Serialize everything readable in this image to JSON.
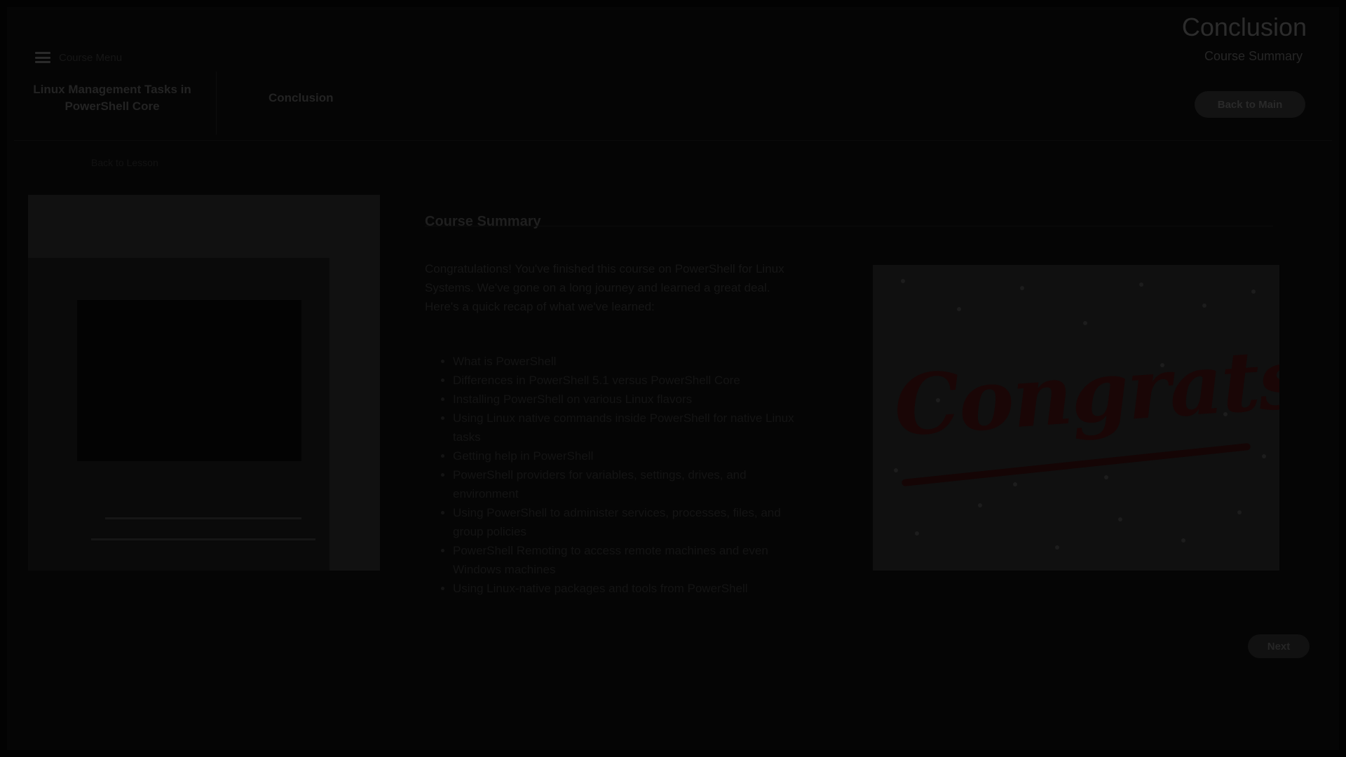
{
  "header": {
    "menu_label": "Course Menu",
    "course_title": "Linux Management Tasks in PowerShell Core",
    "lesson_title": "Conclusion",
    "sub_link": "Back to Lesson",
    "page_title": "Conclusion",
    "page_subtitle": "Course Summary",
    "back_button": "Back to Main"
  },
  "content": {
    "heading": "Course Summary",
    "intro": "Congratulations! You've finished this course on PowerShell for Linux Systems. We've gone on a long journey and learned a great deal. Here's a quick recap of what we've learned:",
    "topics": [
      "What is PowerShell",
      "Differences in PowerShell 5.1 versus PowerShell Core",
      "Installing PowerShell on various Linux flavors",
      "Using Linux native commands inside PowerShell for native Linux tasks",
      "Getting help in PowerShell",
      "PowerShell providers for variables, settings, drives, and environment",
      "Using PowerShell to administer services, processes, files, and group policies",
      "PowerShell Remoting to access remote machines and even Windows machines",
      "Using Linux-native packages and tools from PowerShell"
    ]
  },
  "image": {
    "congrats_text": "Congrats!"
  },
  "footer": {
    "next_button": "Next"
  },
  "colors": {
    "overlay": "#000000",
    "accent": "#8b1a1a"
  },
  "icons": {
    "menu": "hamburger-icon"
  }
}
